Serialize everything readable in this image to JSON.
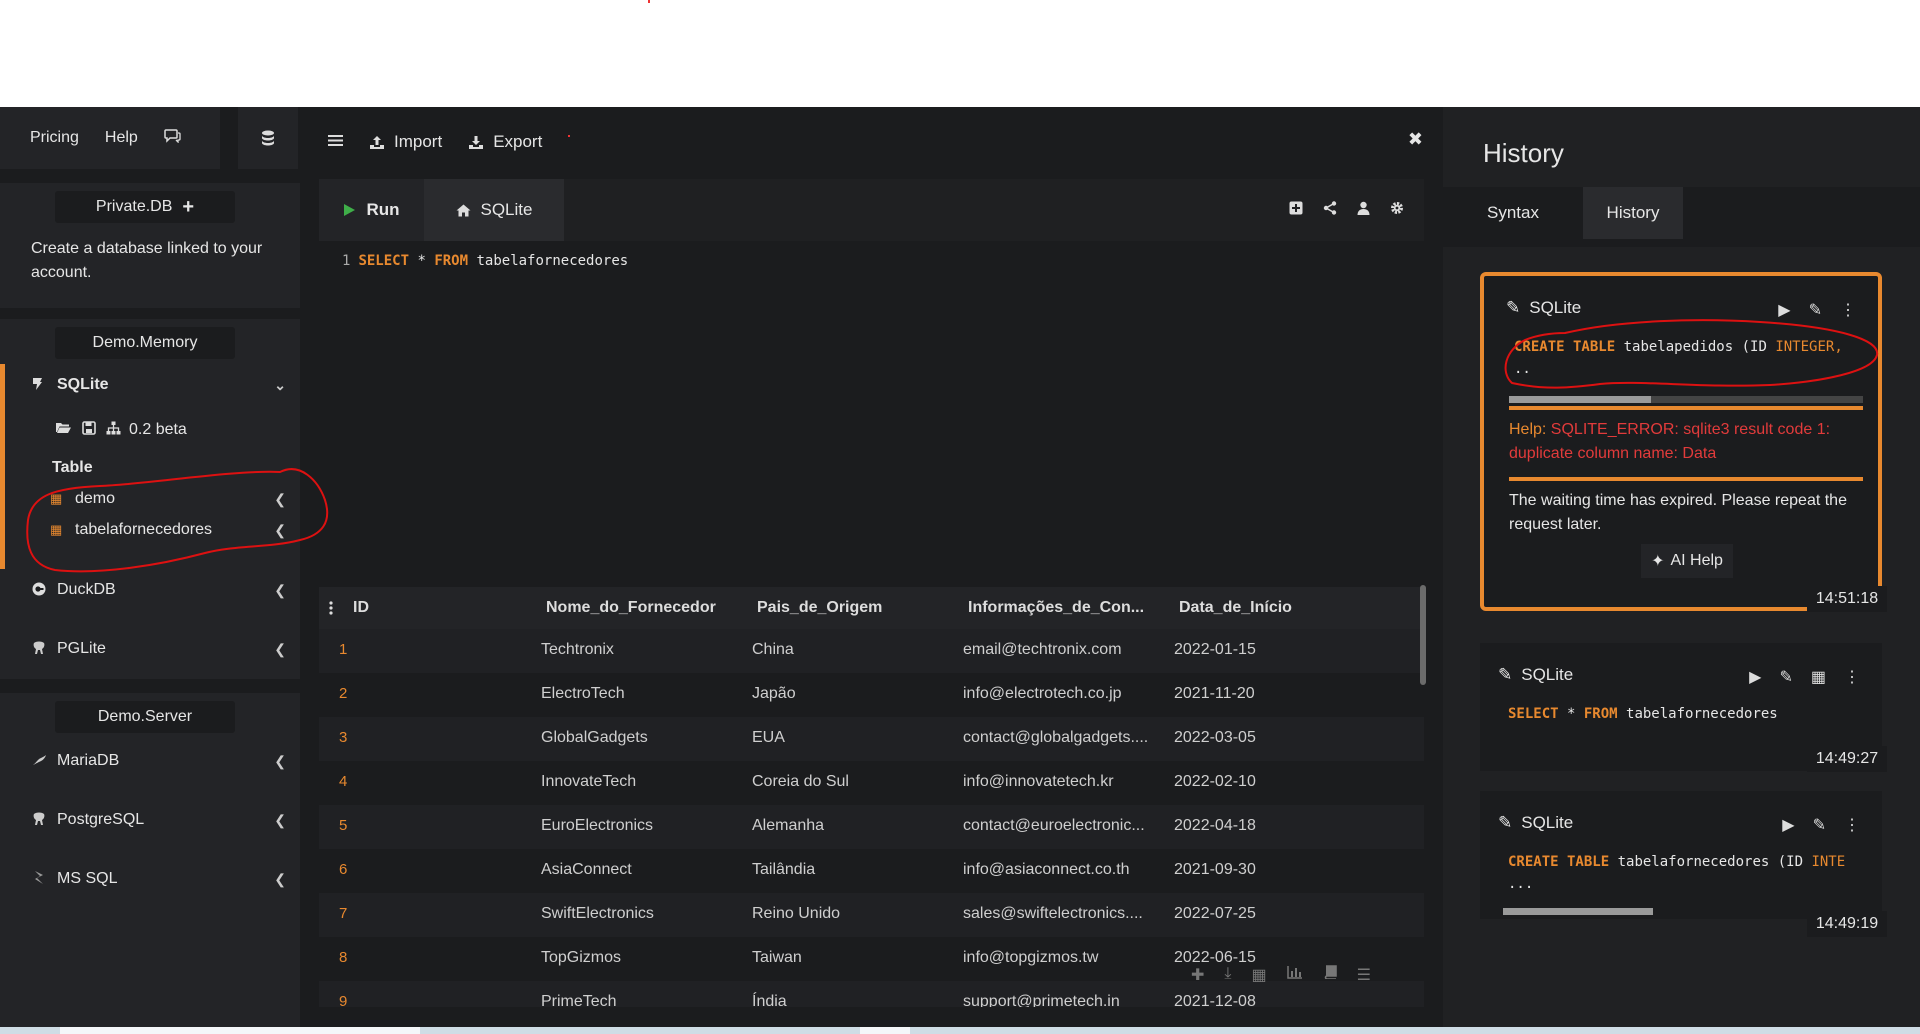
{
  "topbar": {
    "pricing": "Pricing",
    "help": "Help"
  },
  "sidebar": {
    "private_db": "Private.DB",
    "private_desc": "Create a database linked to your account.",
    "demo_memory": "Demo.Memory",
    "sqlite": "SQLite",
    "version": "0.2 beta",
    "table_label": "Table",
    "tables": [
      "demo",
      "tabelafornecedores"
    ],
    "duckdb": "DuckDB",
    "pglite": "PGLite",
    "demo_server": "Demo.Server",
    "mariadb": "MariaDB",
    "postgresql": "PostgreSQL",
    "mssql": "MS SQL"
  },
  "toolbar": {
    "import": "Import",
    "export": "Export"
  },
  "editor": {
    "run": "Run",
    "tab": "SQLite",
    "line_no": "1",
    "kw_select": "SELECT",
    "star": "*",
    "kw_from": "FROM",
    "table": "tabelafornecedores"
  },
  "results": {
    "columns": [
      "ID",
      "Nome_do_Fornecedor",
      "Pais_de_Origem",
      "Informações_de_Con...",
      "Data_de_Início"
    ],
    "rows": [
      [
        "1",
        "Techtronix",
        "China",
        "email@techtronix.com",
        "2022-01-15"
      ],
      [
        "2",
        "ElectroTech",
        "Japão",
        "info@electrotech.co.jp",
        "2021-11-20"
      ],
      [
        "3",
        "GlobalGadgets",
        "EUA",
        "contact@globalgadgets....",
        "2022-03-05"
      ],
      [
        "4",
        "InnovateTech",
        "Coreia do Sul",
        "info@innovatetech.kr",
        "2022-02-10"
      ],
      [
        "5",
        "EuroElectronics",
        "Alemanha",
        "contact@euroelectronic...",
        "2022-04-18"
      ],
      [
        "6",
        "AsiaConnect",
        "Tailândia",
        "info@asiaconnect.co.th",
        "2021-09-30"
      ],
      [
        "7",
        "SwiftElectronics",
        "Reino Unido",
        "sales@swiftelectronics....",
        "2022-07-25"
      ],
      [
        "8",
        "TopGizmos",
        "Taiwan",
        "info@topgizmos.tw",
        "2022-06-15"
      ],
      [
        "9",
        "PrimeTech",
        "Índia",
        "support@primetech.in",
        "2021-12-08"
      ]
    ]
  },
  "history": {
    "title": "History",
    "tab_syntax": "Syntax",
    "tab_history": "History",
    "cards": [
      {
        "engine": "SQLite",
        "code_kw1": "CREATE TABLE",
        "code_rest": " tabelapedidos (ID ",
        "code_kw2": "INTEGER,",
        "code_more": "..",
        "progress": 0.4,
        "help_label": "Help:",
        "help_text": " SQLITE_ERROR: sqlite3 result code 1: duplicate column name: Data",
        "message": "The waiting time has expired. Please repeat the request later.",
        "ai_help": "AI Help",
        "time": "14:51:18"
      },
      {
        "engine": "SQLite",
        "code_kw1": "SELECT",
        "code_mid": " * ",
        "code_kw2": "FROM",
        "code_rest": " tabelafornecedores",
        "time": "14:49:27"
      },
      {
        "engine": "SQLite",
        "code_kw1": "CREATE TABLE",
        "code_rest": " tabelafornecedores (ID ",
        "code_kw2": "INTE",
        "code_more": "...",
        "progress": 0.4,
        "time": "14:49:19"
      }
    ]
  },
  "colors": {
    "accent": "#e8892f",
    "bg": "#1b1c1e",
    "panel": "#232427",
    "error": "#e23b3b",
    "annotation": "#d11"
  }
}
